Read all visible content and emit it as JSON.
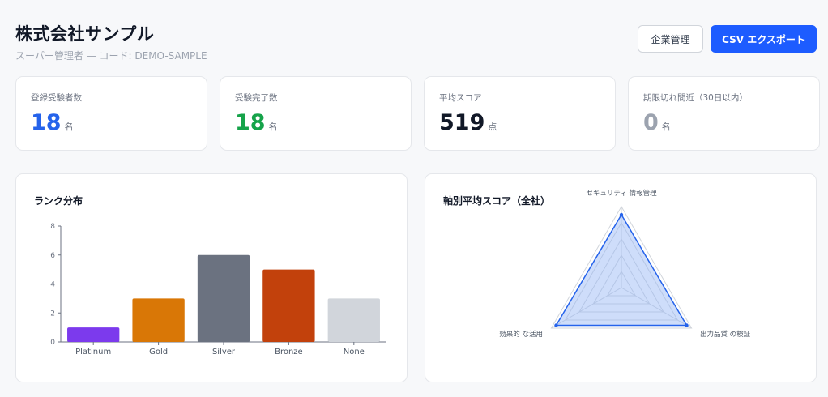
{
  "header": {
    "title": "株式会社サンプル",
    "subtitle": "スーパー管理者 — コード: DEMO-SAMPLE"
  },
  "actions": {
    "company_label": "企業管理",
    "export_label": "CSV エクスポート"
  },
  "stats": [
    {
      "label": "登録受験者数",
      "value": "18",
      "unit": "名",
      "color": "#2563eb"
    },
    {
      "label": "受験完了数",
      "value": "18",
      "unit": "名",
      "color": "#16a34a"
    },
    {
      "label": "平均スコア",
      "value": "519",
      "unit": "点",
      "color": "#111827"
    },
    {
      "label": "期限切れ間近（30日以内）",
      "value": "0",
      "unit": "名",
      "color": "#9ca3af"
    }
  ],
  "panels": {
    "rank_title": "ランク分布",
    "radar_title": "軸別平均スコア（全社）"
  },
  "chart_data": [
    {
      "type": "bar",
      "title": "ランク分布",
      "categories": [
        "Platinum",
        "Gold",
        "Silver",
        "Bronze",
        "None"
      ],
      "values": [
        1,
        3,
        6,
        5,
        3
      ],
      "colors": [
        "#7c3aed",
        "#d97706",
        "#6b7280",
        "#c2410c",
        "#d1d5db"
      ],
      "ylim": [
        0,
        8
      ],
      "yticks": [
        0,
        2,
        4,
        6,
        8
      ],
      "grid": false
    },
    {
      "type": "radar",
      "title": "軸別平均スコア（全社）",
      "categories": [
        "セキュリティ 情報管理",
        "出力品質 の検証",
        "効果的 な活用"
      ],
      "values": [
        0.9,
        0.93,
        0.93
      ],
      "rlim": [
        0,
        1
      ],
      "rings": 5,
      "fill_color": "#93b4f5",
      "line_color": "#2563eb"
    }
  ]
}
